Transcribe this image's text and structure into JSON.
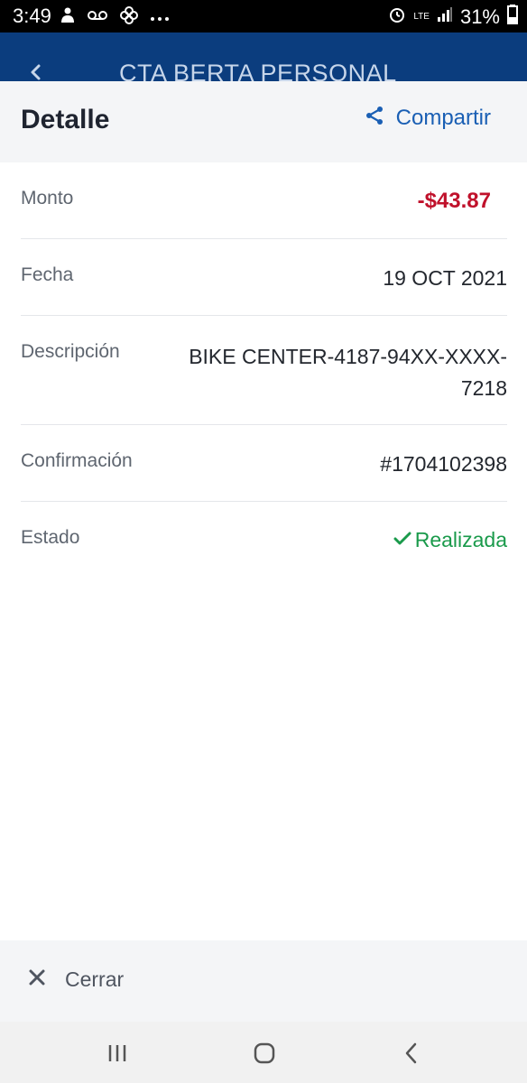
{
  "status_bar": {
    "time": "3:49",
    "battery": "31%",
    "network": "LTE",
    "icons": [
      "person-notification-icon",
      "voicemail-icon",
      "pinwheel-icon",
      "more-dots-icon",
      "alarm-icon",
      "signal-icon"
    ]
  },
  "app_header": {
    "title": "CTA BERTA PERSONAL",
    "background": "#0b3d7e"
  },
  "sheet": {
    "title": "Detalle",
    "share_label": "Compartir",
    "rows": {
      "amount": {
        "label": "Monto",
        "value": "-$43.87"
      },
      "date": {
        "label": "Fecha",
        "value": "19 OCT 2021"
      },
      "description": {
        "label": "Descripción",
        "value": "BIKE CENTER-4187-94XX-XXXX-7218"
      },
      "confirmation": {
        "label": "Confirmación",
        "value": "#1704102398"
      },
      "status": {
        "label": "Estado",
        "value": "Realizada"
      }
    },
    "close_label": "Cerrar"
  },
  "colors": {
    "accent": "#1a5fb4",
    "negative_amount": "#c0112b",
    "success": "#1a9a4b"
  }
}
